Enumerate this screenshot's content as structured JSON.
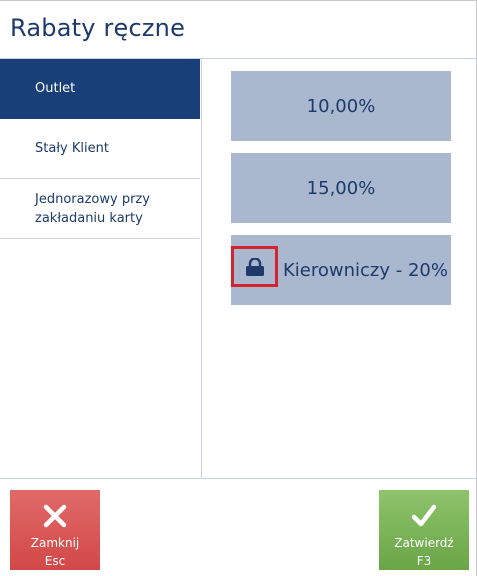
{
  "header": {
    "title": "Rabaty ręczne"
  },
  "sidebar": {
    "items": [
      {
        "label": "Outlet",
        "active": true
      },
      {
        "label": "Stały Klient",
        "active": false
      },
      {
        "label": "Jednorazowy przy zakładaniu karty",
        "active": false
      }
    ]
  },
  "discounts": [
    {
      "label": "10,00%",
      "locked": false
    },
    {
      "label": "15,00%",
      "locked": false
    },
    {
      "label": "Kierowniczy - 20%",
      "locked": true,
      "icon": "lock-icon"
    }
  ],
  "footer": {
    "close": {
      "label": "Zamknij",
      "shortcut": "Esc",
      "icon": "close-icon",
      "color": "#d8504f"
    },
    "confirm": {
      "label": "Zatwierdź",
      "shortcut": "F3",
      "icon": "check-icon",
      "color": "#79b355"
    }
  },
  "colors": {
    "accent": "#183f78",
    "tile": "#aab8cf",
    "highlight": "#d4242d"
  }
}
